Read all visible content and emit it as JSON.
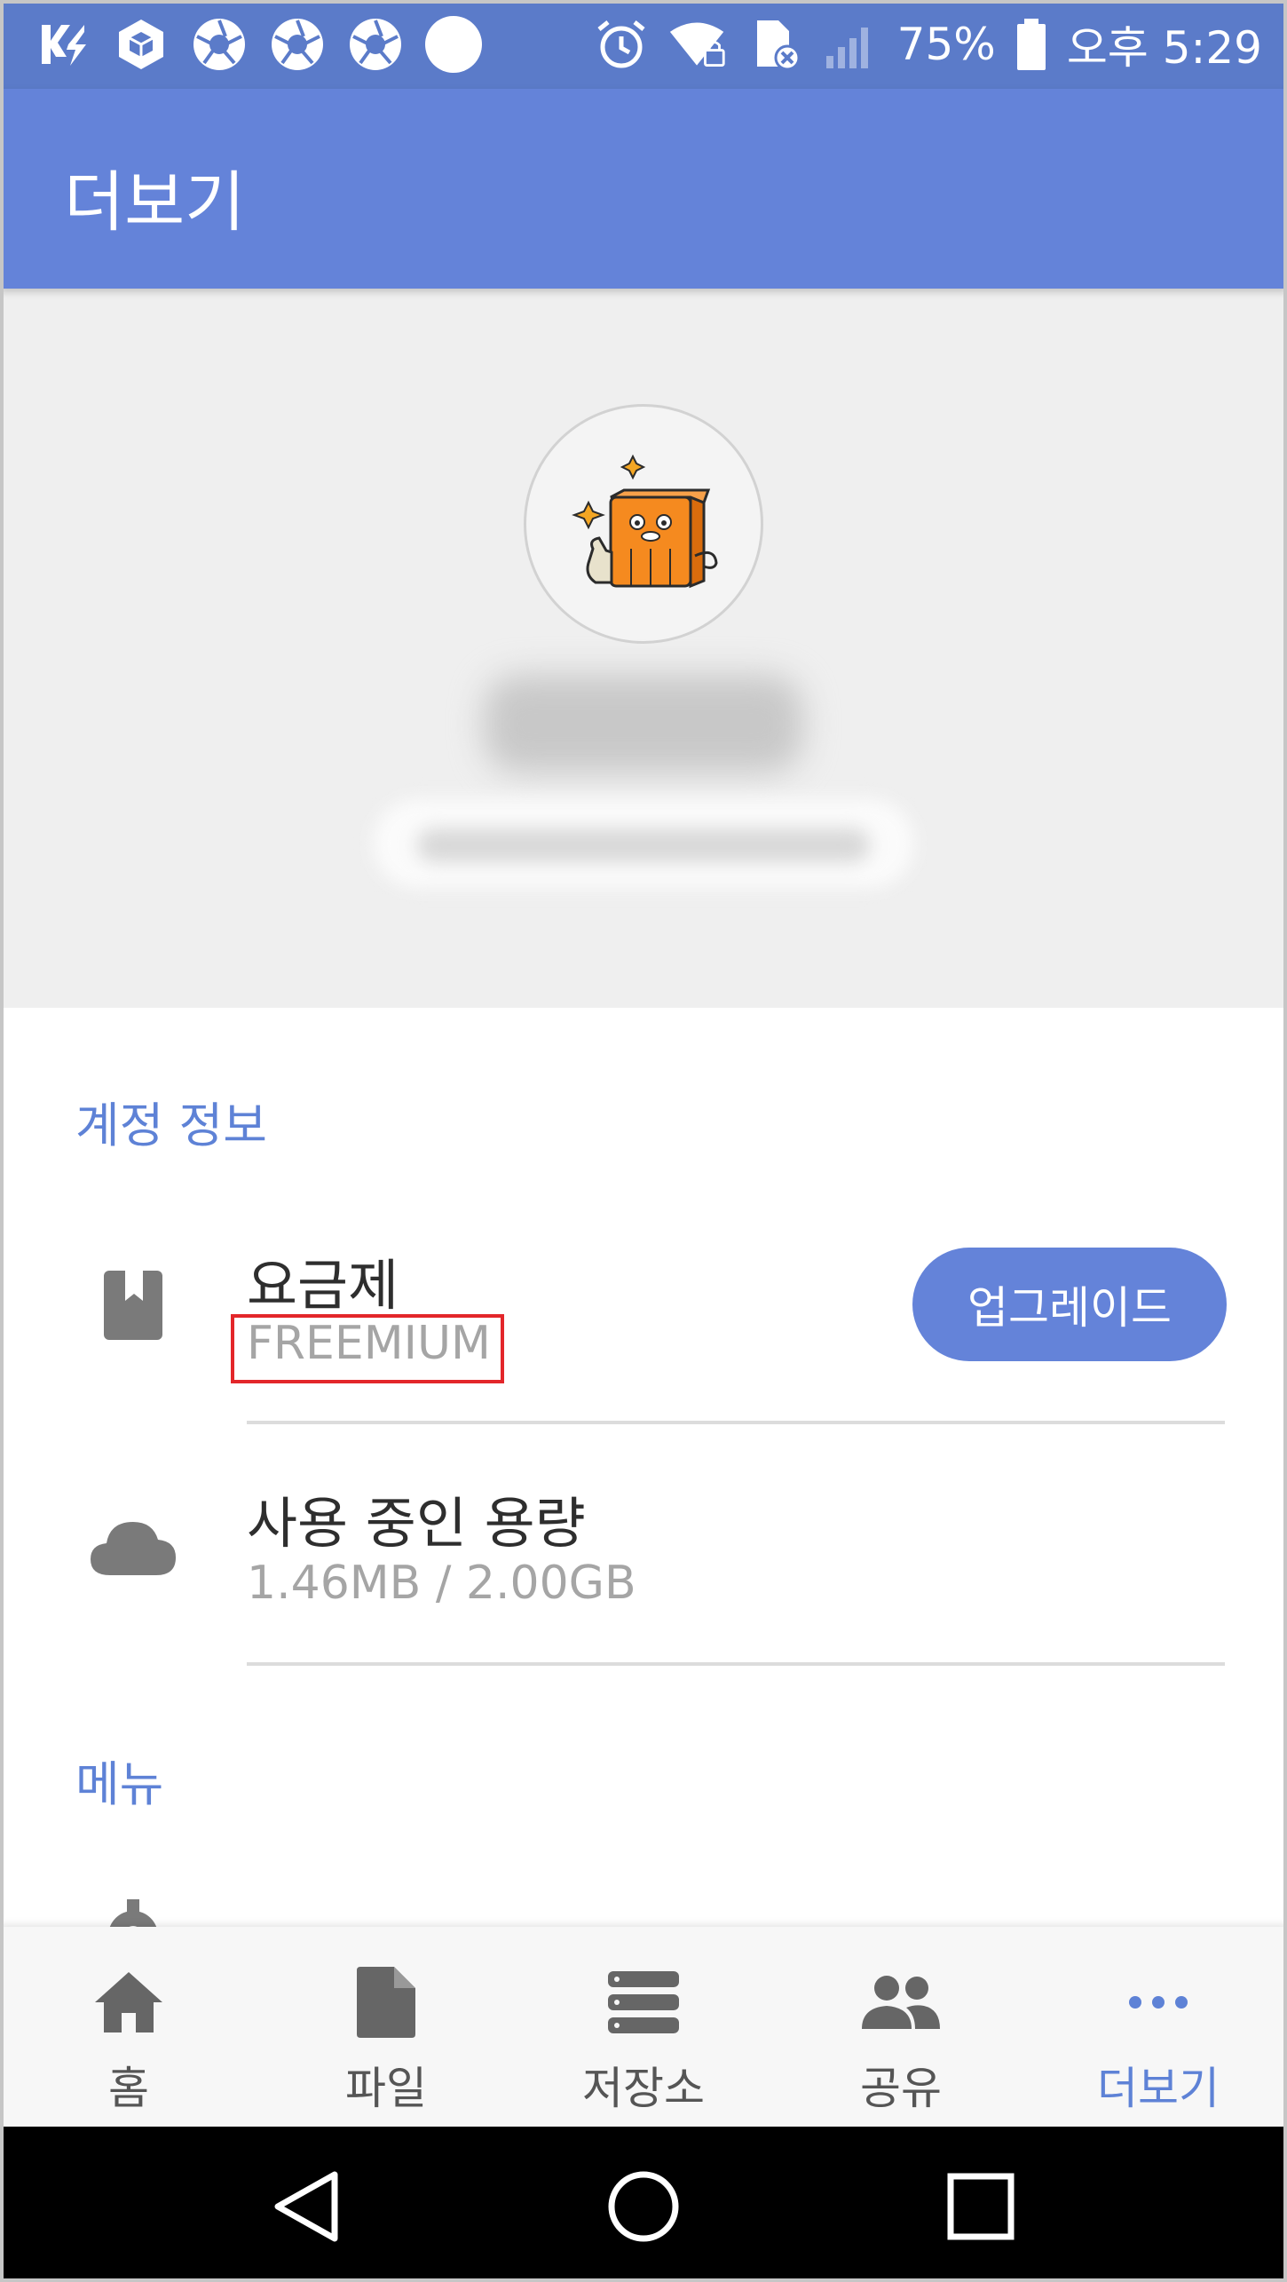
{
  "status_bar": {
    "left_icons": [
      "kakao-talk-icon",
      "cube-icon",
      "shutter-icon",
      "shutter-icon",
      "shutter-icon",
      "circle-icon"
    ],
    "right_icons": [
      "alarm-icon",
      "wifi-locked-icon",
      "sim-error-icon",
      "signal-icon",
      "battery-icon"
    ],
    "battery": "75%",
    "time": "오후 5:29"
  },
  "app_bar": {
    "title": "더보기"
  },
  "account_section": {
    "label": "계정 정보",
    "plan": {
      "title": "요금제",
      "value": "FREEMIUM",
      "icon": "book-icon",
      "button": "업그레이드"
    },
    "storage": {
      "title": "사용 중인 용량",
      "value": "1.46MB / 2.00GB",
      "icon": "cloud-icon"
    }
  },
  "menu_section": {
    "label": "메뉴",
    "first_item_icon": "gear-icon"
  },
  "bottom_nav": [
    {
      "label": "홈",
      "icon": "home-icon",
      "active": false
    },
    {
      "label": "파일",
      "icon": "file-icon",
      "active": false
    },
    {
      "label": "저장소",
      "icon": "storage-icon",
      "active": false
    },
    {
      "label": "공유",
      "icon": "people-icon",
      "active": false
    },
    {
      "label": "더보기",
      "icon": "more-icon",
      "active": true
    }
  ],
  "colors": {
    "status_bar": "#5b7bc9",
    "app_bar": "#6483d9",
    "accent": "#5e82d6",
    "highlight_box": "#e3262a"
  }
}
